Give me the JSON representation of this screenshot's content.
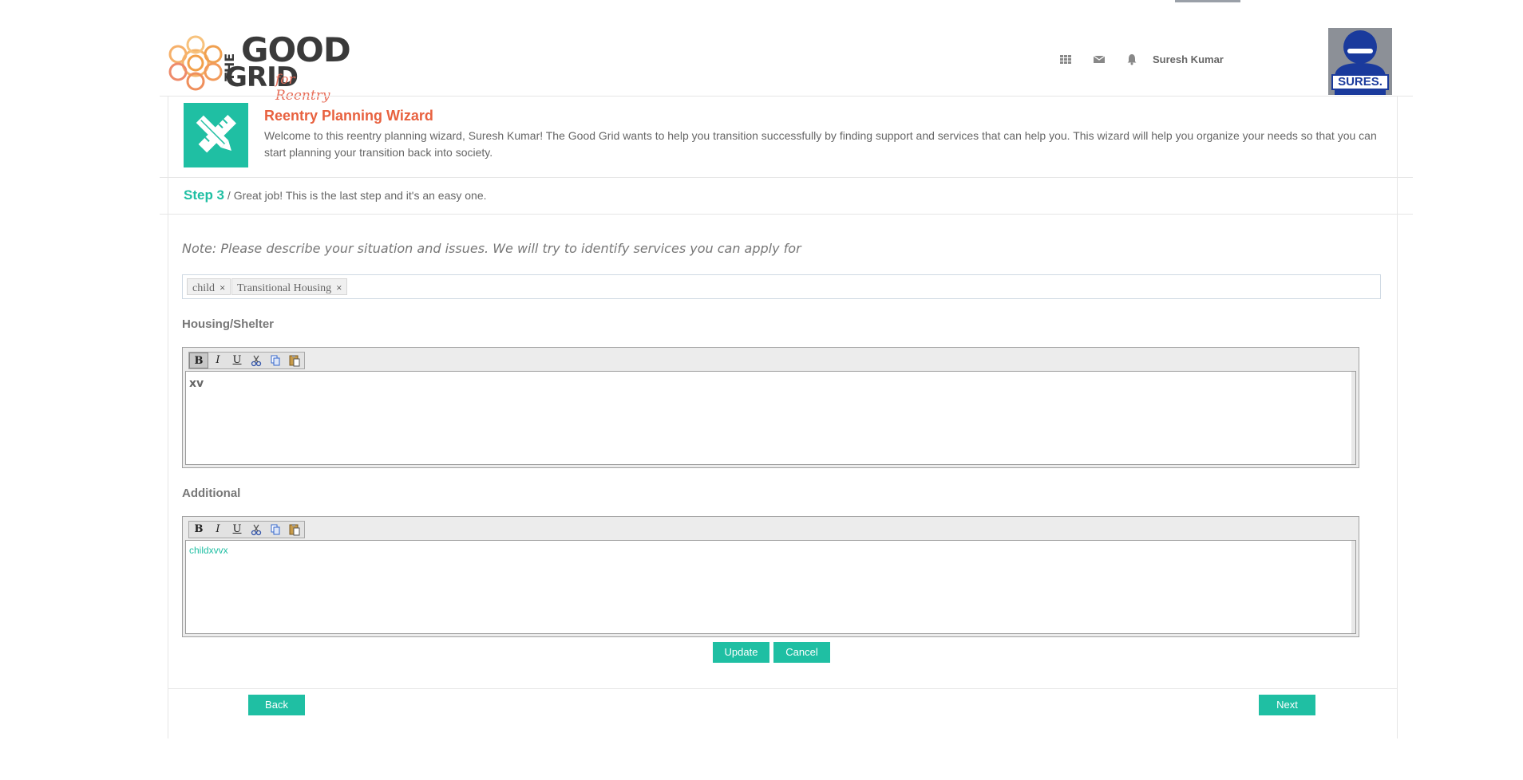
{
  "logo": {
    "the": "THE",
    "good": "GOOD",
    "grid": "GRID",
    "tagline": "for Reentry"
  },
  "header": {
    "user_name": "Suresh Kumar",
    "icons": [
      "apps-grid-icon",
      "envelope-icon",
      "bell-icon"
    ],
    "avatar_badge": "SURES."
  },
  "wizard": {
    "title": "Reentry Planning Wizard",
    "description": "Welcome to this reentry planning wizard, Suresh Kumar! The Good Grid wants to help you transition successfully by finding support and services that can help you. This wizard will help you organize your needs so that you can start planning your transition back into society.",
    "step_label": "Step 3",
    "step_text": " / Great job! This is the last step and it's an easy one."
  },
  "note": "Note: Please describe your situation and issues. We will try to identify services you can apply for",
  "tags": [
    {
      "label": "child",
      "remove": "×"
    },
    {
      "label": "Transitional Housing",
      "remove": "×"
    }
  ],
  "editors": [
    {
      "label": "Housing/Shelter",
      "content": "xv",
      "content_color": "#666666"
    },
    {
      "label": "Additional",
      "content": "childxvvx",
      "content_color": "#1fbfa3"
    }
  ],
  "toolbar": {
    "bold": "B",
    "italic": "I",
    "underline": "U"
  },
  "buttons": {
    "update": "Update",
    "cancel": "Cancel",
    "back": "Back",
    "next": "Next"
  },
  "colors": {
    "accent": "#1fbfa3",
    "title": "#e8613f"
  }
}
